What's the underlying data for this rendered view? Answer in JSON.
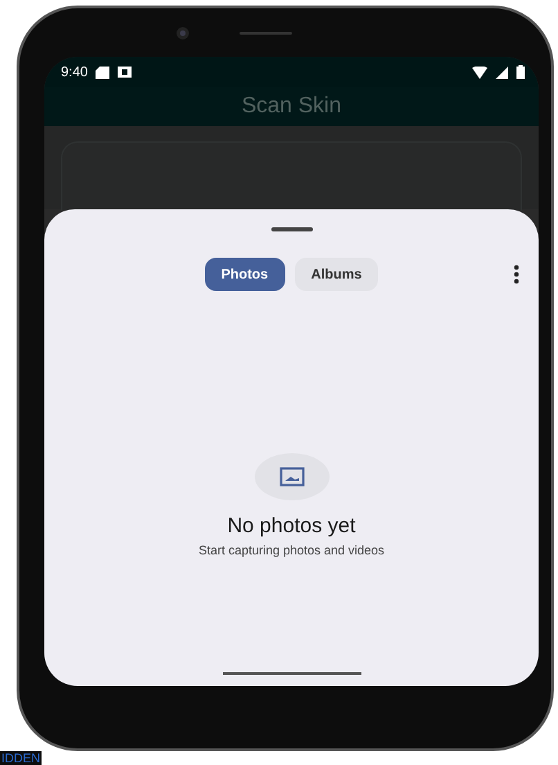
{
  "status_bar": {
    "time": "9:40"
  },
  "app_bar": {
    "title": "Scan Skin"
  },
  "picker": {
    "tabs": [
      {
        "label": "Photos",
        "selected": true
      },
      {
        "label": "Albums",
        "selected": false
      }
    ],
    "empty_state": {
      "title": "No photos yet",
      "subtitle": "Start capturing photos and videos"
    }
  },
  "background_text": "IDDEN"
}
